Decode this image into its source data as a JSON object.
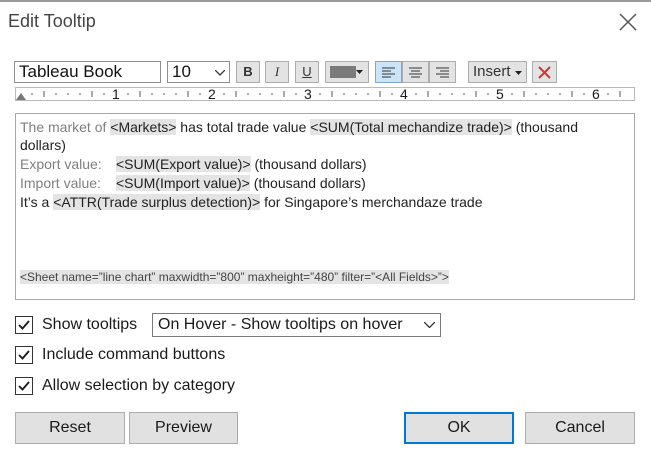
{
  "dialog": {
    "title": "Edit Tooltip",
    "close_icon": "close-icon"
  },
  "toolbar": {
    "font_family": "Tableau Book",
    "font_size": "10",
    "bold_label": "B",
    "italic_label": "I",
    "underline_label": "U",
    "font_color": "#7a7a7a",
    "insert_label": "Insert",
    "clear_color": "#d9342b"
  },
  "ruler": {
    "numbers": [
      "1",
      "2",
      "3",
      "4",
      "5",
      "6"
    ]
  },
  "editor": {
    "line1": {
      "t1": "The market of ",
      "f1": "<Markets>",
      "t2": " has total  trade value ",
      "f2": "<SUM(Total mechandize trade)>",
      "t3": "  (thousand"
    },
    "line1b": "dollars)",
    "line2": {
      "label": "Export value: ",
      "field": "<SUM(Export value)>",
      "suffix": " (thousand dollars)"
    },
    "line3": {
      "label": "Import value: ",
      "field": "<SUM(Import value)>",
      "suffix": " (thousand dollars)"
    },
    "line4": {
      "prefix": "It’s a ",
      "field": "<ATTR(Trade surplus detection)>",
      "suffix": " for Singapore’s merchandaze trade"
    },
    "sheet_tag": "<Sheet name=”line chart” maxwidth=”800” maxheight=”480” filter=”<All Fields>”>"
  },
  "options": {
    "show_tooltips": {
      "label": "Show tooltips",
      "checked": true
    },
    "tooltip_mode": "On Hover - Show tooltips on hover",
    "include_command_buttons": {
      "label": "Include command buttons",
      "checked": true
    },
    "allow_selection": {
      "label": "Allow selection by category",
      "checked": true
    }
  },
  "buttons": {
    "reset": "Reset",
    "preview": "Preview",
    "ok": "OK",
    "cancel": "Cancel"
  }
}
